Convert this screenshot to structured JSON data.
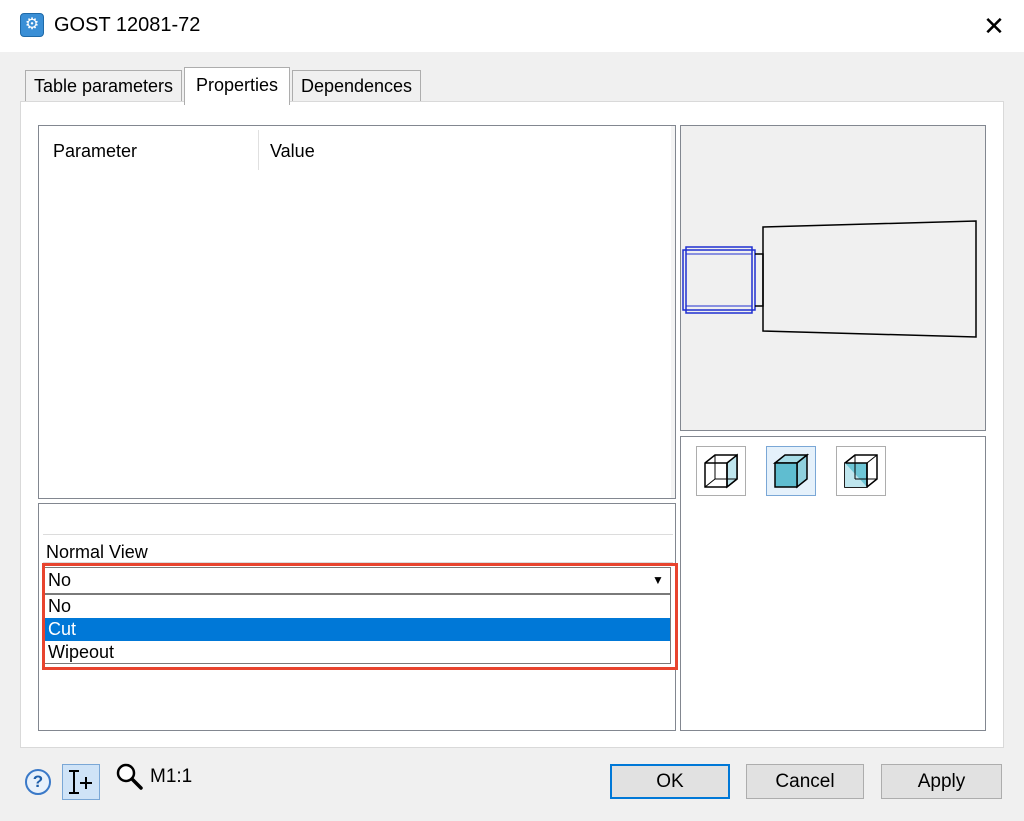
{
  "window": {
    "title": "GOST 12081-72",
    "close_glyph": "✕",
    "app_icon": "gear-icon"
  },
  "tabs": [
    {
      "label": "Table parameters",
      "active": false
    },
    {
      "label": "Properties",
      "active": true
    },
    {
      "label": "Dependences",
      "active": false
    }
  ],
  "parameter_table": {
    "columns": [
      "Parameter",
      "Value"
    ],
    "rows": []
  },
  "properties": {
    "field_label": "Normal View",
    "combo_value": "No",
    "options": [
      {
        "label": "No",
        "selected": false
      },
      {
        "label": "Cut",
        "selected": true
      },
      {
        "label": "Wipeout",
        "selected": false
      }
    ]
  },
  "view_buttons": [
    {
      "icon": "wireframe-cube-icon",
      "active": false
    },
    {
      "icon": "shaded-cube-icon",
      "active": true
    },
    {
      "icon": "shaded-edges-cube-icon",
      "active": false
    }
  ],
  "footer": {
    "help_glyph": "?",
    "zoom_label": "M1:1",
    "ok_label": "OK",
    "cancel_label": "Cancel",
    "apply_label": "Apply"
  },
  "colors": {
    "selection": "#0078d7",
    "highlight_border": "#e8442e",
    "preview_stroke_blue": "#1f2fd0",
    "shaded_face": "#6ec6d6"
  }
}
